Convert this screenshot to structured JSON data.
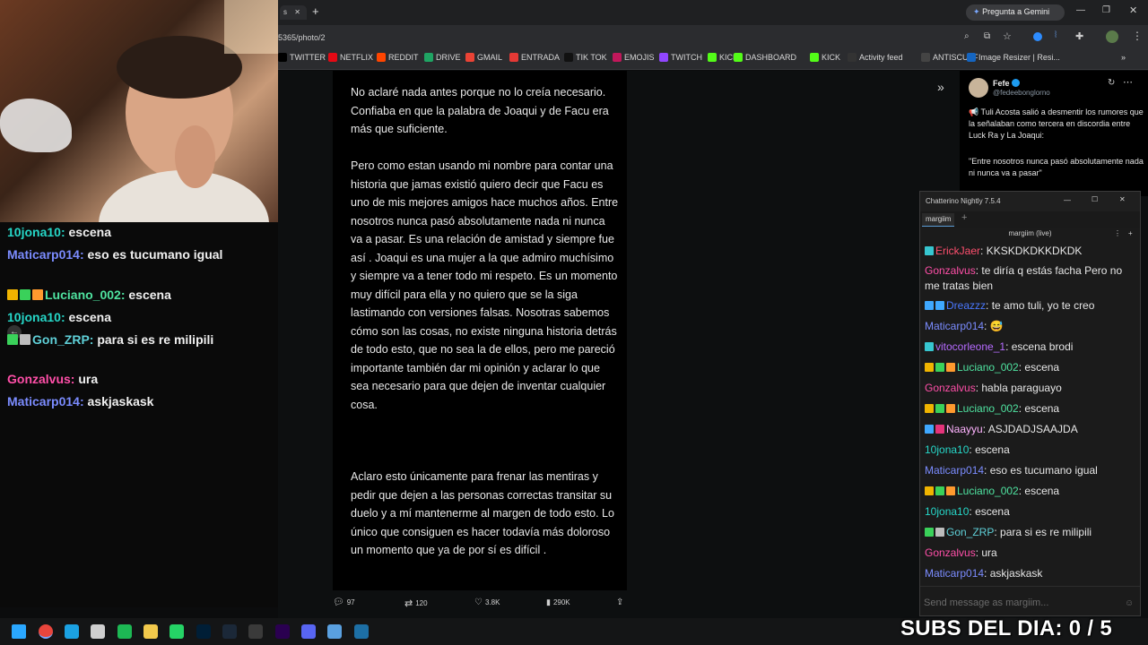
{
  "browser": {
    "tab_icon": "chrome-icon",
    "tab_fragment": "s",
    "new_tab_glyph": "+",
    "url": "5365/photo/2",
    "gemini_label": "Pregunta a Gemini",
    "bookmarks": [
      {
        "label": "TWITTER",
        "color": "#000000",
        "icon": "x-icon"
      },
      {
        "label": "NETFLIX",
        "color": "#e50914",
        "icon": "netflix-icon"
      },
      {
        "label": "REDDIT",
        "color": "#ff4500",
        "icon": "reddit-icon"
      },
      {
        "label": "DRIVE",
        "color": "#1fa463",
        "icon": "drive-icon"
      },
      {
        "label": "GMAIL",
        "color": "#ea4335",
        "icon": "gmail-icon"
      },
      {
        "label": "ENTRADA",
        "color": "#e53935",
        "icon": "link-icon"
      },
      {
        "label": "TIK TOK",
        "color": "#111111",
        "icon": "tiktok-icon"
      },
      {
        "label": "EMOJIS",
        "color": "#c2185b",
        "icon": "emoji-icon"
      },
      {
        "label": "TWITCH",
        "color": "#9146ff",
        "icon": "twitch-icon"
      },
      {
        "label": "KICK",
        "color": "#53fc18",
        "icon": "kick-icon"
      },
      {
        "label": "DASHBOARD",
        "color": "#53fc18",
        "icon": "kick-icon"
      },
      {
        "label": "KICK",
        "color": "#53fc18",
        "icon": "kick-icon"
      },
      {
        "label": "Activity feed",
        "color": "#333333",
        "icon": "activity-icon"
      },
      {
        "label": "ANTISCUFF",
        "color": "#444444",
        "icon": "antiscuff-icon"
      },
      {
        "label": "Image Resizer | Resi...",
        "color": "#1565c0",
        "icon": "resizer-icon"
      }
    ]
  },
  "overlay_chat": [
    {
      "user": "10jona10",
      "user_color": "#26d7c8",
      "text": "escena",
      "badges": []
    },
    {
      "user": "Maticarp014",
      "user_color": "#7b8cff",
      "text": "eso es tucumano igual",
      "badges": []
    },
    {
      "user": "Luciano_002",
      "user_color": "#4fe3a0",
      "text": "escena",
      "badges": [
        "#f0b400",
        "#3ad15a",
        "#ff9a2e"
      ]
    },
    {
      "user": "10jona10",
      "user_color": "#26d7c8",
      "text": "escena",
      "badges": []
    },
    {
      "user": "Gon_ZRP",
      "user_color": "#5fd0d8",
      "text": "para si es re milipili",
      "badges": [
        "#3ad15a",
        "#bdbdbd"
      ]
    },
    {
      "user": "Gonzalvus",
      "user_color": "#ff4fa8",
      "text": "ura",
      "badges": []
    },
    {
      "user": "Maticarp014",
      "user_color": "#7b8cff",
      "text": "askjaskask",
      "badges": []
    }
  ],
  "tweet_image": {
    "paragraphs": [
      "No aclaré nada antes porque no lo creía necesario. Confiaba en que la palabra de Joaqui y de Facu era más que suficiente.",
      "Pero como estan usando mi nombre para contar una historia que  jamas existió quiero decir que Facu es uno de mis mejores amigos hace muchos años. Entre nosotros nunca pasó absolutamente nada ni nunca va a pasar. Es una relación de amistad y  siempre fue así . Joaqui es una mujer a la que admiro muchísimo y siempre va a tener todo mi respeto. Es un momento muy difícil para ella y no quiero que se la siga lastimando con versiones falsas. Nosotras sabemos cómo son las cosas,  no existe ninguna historia detrás de todo esto, que no sea la de ellos, pero me pareció importante también dar mi opinión y aclarar lo que sea necesario para que dejen de inventar cualquier cosa.",
      "Aclaro esto únicamente para frenar las mentiras y pedir que dejen a las personas correctas transitar su duelo y a mí mantenerme al margen de todo esto. Lo único que consiguen es hacer todavía más doloroso un momento que ya de por sí es difícil ."
    ],
    "actions": {
      "replies": "97",
      "reposts": "120",
      "likes": "3.8K",
      "views": "290K"
    }
  },
  "x_post": {
    "author": "Fefe",
    "handle": "@fedeebonglorno",
    "text1": "📢 Tuli Acosta salió a desmentir los rumores que la señalaban como tercera en discordia entre Luck Ra y La Joaqui:",
    "text2": "\"Entre nosotros nunca pasó absolutamente nada ni nunca va a pasar\""
  },
  "chatterino": {
    "title": "Chatterino Nightly 7.5.4",
    "tab": "margiim",
    "channel": "margiim (live)",
    "input_placeholder": "Send message as margiim...",
    "messages": [
      {
        "user": "ErickJaer",
        "user_color": "#ff4f6e",
        "text": "KKSKDKDKKDKDK",
        "badges": [
          "#37c6d0"
        ]
      },
      {
        "user": "Gonzalvus",
        "user_color": "#ff4fa8",
        "text": "te diría q estás facha Pero no me tratas bien",
        "badges": []
      },
      {
        "user": "Dreazzz",
        "user_color": "#4a78ff",
        "text": "te amo tuli, yo te creo",
        "badges": [
          "#3fa8ff",
          "#3fa8ff"
        ]
      },
      {
        "user": "Maticarp014",
        "user_color": "#7b8cff",
        "text": "😅",
        "badges": []
      },
      {
        "user": "vitocorleone_1",
        "user_color": "#b66bff",
        "text": "escena brodi",
        "badges": [
          "#37c6d0"
        ]
      },
      {
        "user": "Luciano_002",
        "user_color": "#4fe3a0",
        "text": "escena",
        "badges": [
          "#f0b400",
          "#3ad15a",
          "#ff9a2e"
        ]
      },
      {
        "user": "Gonzalvus",
        "user_color": "#ff4fa8",
        "text": "habla paraguayo",
        "badges": []
      },
      {
        "user": "Luciano_002",
        "user_color": "#4fe3a0",
        "text": "escena",
        "badges": [
          "#f0b400",
          "#3ad15a",
          "#ff9a2e"
        ]
      },
      {
        "user": "Naayyu",
        "user_color": "#ffb3ff",
        "text": "ASJDADJSAAJDA",
        "badges": [
          "#3fa8ff",
          "#e5337a"
        ]
      },
      {
        "user": "10jona10",
        "user_color": "#26d7c8",
        "text": "escena",
        "badges": []
      },
      {
        "user": "Maticarp014",
        "user_color": "#7b8cff",
        "text": "eso es tucumano igual",
        "badges": []
      },
      {
        "user": "Luciano_002",
        "user_color": "#4fe3a0",
        "text": "escena",
        "badges": [
          "#f0b400",
          "#3ad15a",
          "#ff9a2e"
        ]
      },
      {
        "user": "10jona10",
        "user_color": "#26d7c8",
        "text": "escena",
        "badges": []
      },
      {
        "user": "Gon_ZRP",
        "user_color": "#5fd0d8",
        "text": "para si es re milipili",
        "badges": [
          "#3ad15a",
          "#bdbdbd"
        ]
      },
      {
        "user": "Gonzalvus",
        "user_color": "#ff4fa8",
        "text": "ura",
        "badges": []
      },
      {
        "user": "Maticarp014",
        "user_color": "#7b8cff",
        "text": "askjaskask",
        "badges": []
      }
    ]
  },
  "subs_counter": "SUBS DEL DIA: 0 / 5",
  "taskbar": {
    "apps": [
      {
        "name": "windows-start-icon",
        "color": "#2aa7ff"
      },
      {
        "name": "chrome-icon",
        "color": "#e8453c"
      },
      {
        "name": "edge-icon",
        "color": "#1ba1e2"
      },
      {
        "name": "capture-icon",
        "color": "#cfcfcf"
      },
      {
        "name": "spotify-icon",
        "color": "#1db954"
      },
      {
        "name": "folder-icon",
        "color": "#f2c94c"
      },
      {
        "name": "whatsapp-icon",
        "color": "#25d366"
      },
      {
        "name": "photoshop-icon",
        "color": "#001e36"
      },
      {
        "name": "steam-icon",
        "color": "#1b2838"
      },
      {
        "name": "obs-icon",
        "color": "#3a3a3a"
      },
      {
        "name": "premiere-icon",
        "color": "#2a0050"
      },
      {
        "name": "discord-icon",
        "color": "#5865f2"
      },
      {
        "name": "notes-icon",
        "color": "#5aa0e0"
      },
      {
        "name": "chatterino-icon",
        "color": "#1d6fa5"
      }
    ]
  }
}
